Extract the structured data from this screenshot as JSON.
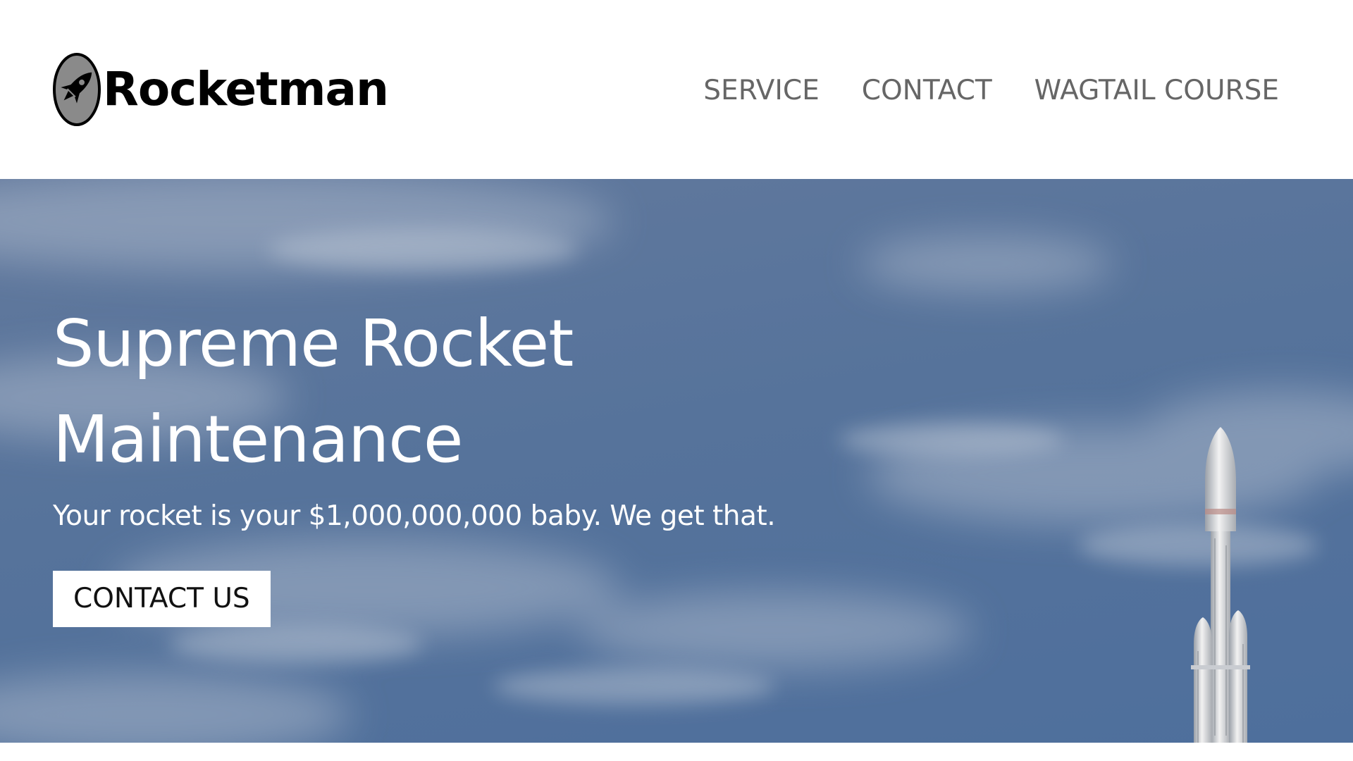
{
  "header": {
    "brand_name": "Rocketman",
    "logo_icon": "rocket-icon",
    "nav": [
      {
        "label": "SERVICE"
      },
      {
        "label": "CONTACT"
      },
      {
        "label": "WAGTAIL COURSE"
      }
    ]
  },
  "hero": {
    "title": "Supreme Rocket Maintenance",
    "subtitle": "Your rocket is your $1,000,000,000 baby. We get that.",
    "cta_label": "CONTACT US",
    "background_image": "sky-with-rocket-launch"
  },
  "colors": {
    "header_bg": "#ffffff",
    "nav_text": "#666666",
    "hero_sky": "#56739b",
    "hero_text": "#ffffff",
    "cta_bg": "#ffffff",
    "cta_text": "#111111"
  }
}
